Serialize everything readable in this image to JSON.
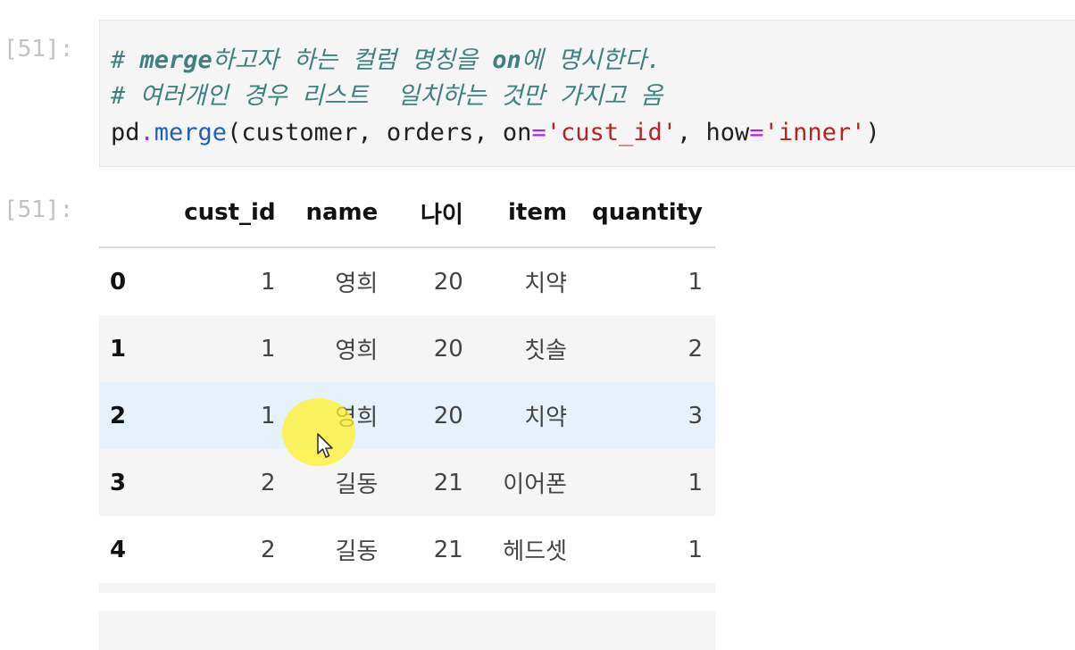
{
  "cells": {
    "input_prompt": "[51]:",
    "output_prompt": "[51]:",
    "code": {
      "line1": {
        "hash": "# ",
        "word_merge": "merge",
        "korean_1": "하고자 하는 컬럼 명칭을 ",
        "word_on": "on",
        "korean_2": "에 명시한다."
      },
      "line2": "# 여러개인 경우 리스트  일치하는 것만 가지고 옴",
      "line3": {
        "obj": "pd",
        "dot": ".",
        "func": "merge",
        "open": "(customer, orders, on",
        "eq1": "=",
        "str1": "'cust_id'",
        "mid": ", how",
        "eq2": "=",
        "str2": "'inner'",
        "close": ")"
      }
    }
  },
  "table": {
    "columns": [
      "",
      "cust_id",
      "name",
      "나이",
      "item",
      "quantity"
    ],
    "rows": [
      {
        "index": "0",
        "cust_id": "1",
        "name": "영희",
        "age": "20",
        "item": "치약",
        "quantity": "1"
      },
      {
        "index": "1",
        "cust_id": "1",
        "name": "영희",
        "age": "20",
        "item": "칫솔",
        "quantity": "2"
      },
      {
        "index": "2",
        "cust_id": "1",
        "name": "영희",
        "age": "20",
        "item": "치약",
        "quantity": "3"
      },
      {
        "index": "3",
        "cust_id": "2",
        "name": "길동",
        "age": "21",
        "item": "이어폰",
        "quantity": "1"
      },
      {
        "index": "4",
        "cust_id": "2",
        "name": "길동",
        "age": "21",
        "item": "헤드셋",
        "quantity": "1"
      }
    ]
  },
  "colors": {
    "prompt": "#c2c2c2",
    "comment": "#408080",
    "string": "#ba2121",
    "operator": "#aa22ff",
    "row_stripe": "#f5f5f5",
    "row_hover": "#e6f1fb",
    "cursor_highlight": "#fff028"
  }
}
